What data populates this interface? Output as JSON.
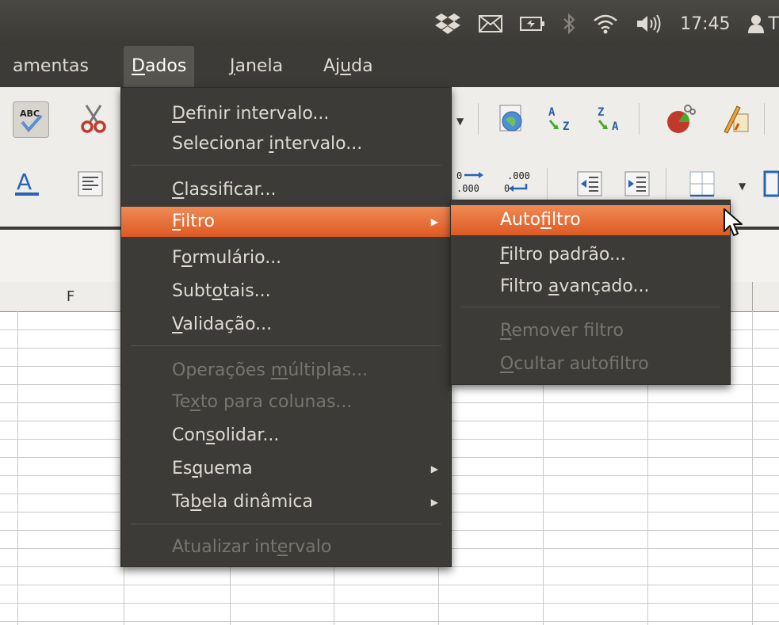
{
  "panel": {
    "clock": "17:45",
    "user": "T"
  },
  "menubar": {
    "items": [
      {
        "label_pre": "",
        "label_u": "",
        "label_post": "amentas"
      },
      {
        "label_pre": "",
        "label_u": "D",
        "label_post": "ados"
      },
      {
        "label_pre": "",
        "label_u": "J",
        "label_post": "anela"
      },
      {
        "label_pre": "Aj",
        "label_u": "u",
        "label_post": "da"
      }
    ]
  },
  "grid": {
    "column_header": "F"
  },
  "dados_menu": {
    "items": [
      {
        "pre": "",
        "u": "D",
        "post": "efinir intervalo...",
        "enabled": true
      },
      {
        "pre": "Selecionar ",
        "u": "i",
        "post": "ntervalo...",
        "enabled": true
      },
      {
        "pre": "",
        "u": "C",
        "post": "lassificar...",
        "enabled": true
      },
      {
        "pre": "",
        "u": "F",
        "post": "iltro",
        "enabled": true,
        "submenu": true,
        "highlighted": true
      },
      {
        "pre": "F",
        "u": "o",
        "post": "rmulário...",
        "enabled": true
      },
      {
        "pre": "Subt",
        "u": "o",
        "post": "tais...",
        "enabled": true
      },
      {
        "pre": "",
        "u": "V",
        "post": "alidação...",
        "enabled": true
      },
      {
        "pre": "Operações ",
        "u": "m",
        "post": "últiplas...",
        "enabled": false
      },
      {
        "pre": "Te",
        "u": "x",
        "post": "to para colunas...",
        "enabled": false
      },
      {
        "pre": "Con",
        "u": "s",
        "post": "olidar...",
        "enabled": true
      },
      {
        "pre": "Es",
        "u": "q",
        "post": "uema",
        "enabled": true,
        "submenu": true
      },
      {
        "pre": "Ta",
        "u": "b",
        "post": "ela dinâmica",
        "enabled": true,
        "submenu": true
      },
      {
        "pre": "Atualizar int",
        "u": "e",
        "post": "rvalo",
        "enabled": false
      }
    ]
  },
  "filtro_submenu": {
    "items": [
      {
        "pre": "Auto",
        "u": "f",
        "post": "iltro",
        "enabled": true,
        "highlighted": true
      },
      {
        "pre": "",
        "u": "F",
        "post": "iltro padrão...",
        "enabled": true
      },
      {
        "pre": "Filtro ",
        "u": "a",
        "post": "vançado...",
        "enabled": true
      },
      {
        "pre": "",
        "u": "R",
        "post": "emover filtro",
        "enabled": false
      },
      {
        "pre": "",
        "u": "O",
        "post": "cultar autofiltro",
        "enabled": false
      }
    ]
  },
  "icons": {
    "tray": [
      "dropbox-icon",
      "mail-icon",
      "battery-icon",
      "bluetooth-icon",
      "wifi-icon",
      "volume-icon"
    ],
    "toolbar": [
      "spellcheck-icon",
      "cut-icon",
      "navigator-icon",
      "sort-ascending-icon",
      "sort-descending-icon",
      "chart-icon",
      "draw-functions-icon",
      "font-color-icon",
      "align-left-icon",
      "add-decimal-icon",
      "delete-decimal-icon",
      "decrease-indent-icon",
      "increase-indent-icon",
      "borders-icon"
    ]
  },
  "colors": {
    "menu_bg": "#3c3b37",
    "highlight": "#e8703a",
    "menu_text": "#dfdbd2",
    "disabled_text": "#77756f"
  }
}
